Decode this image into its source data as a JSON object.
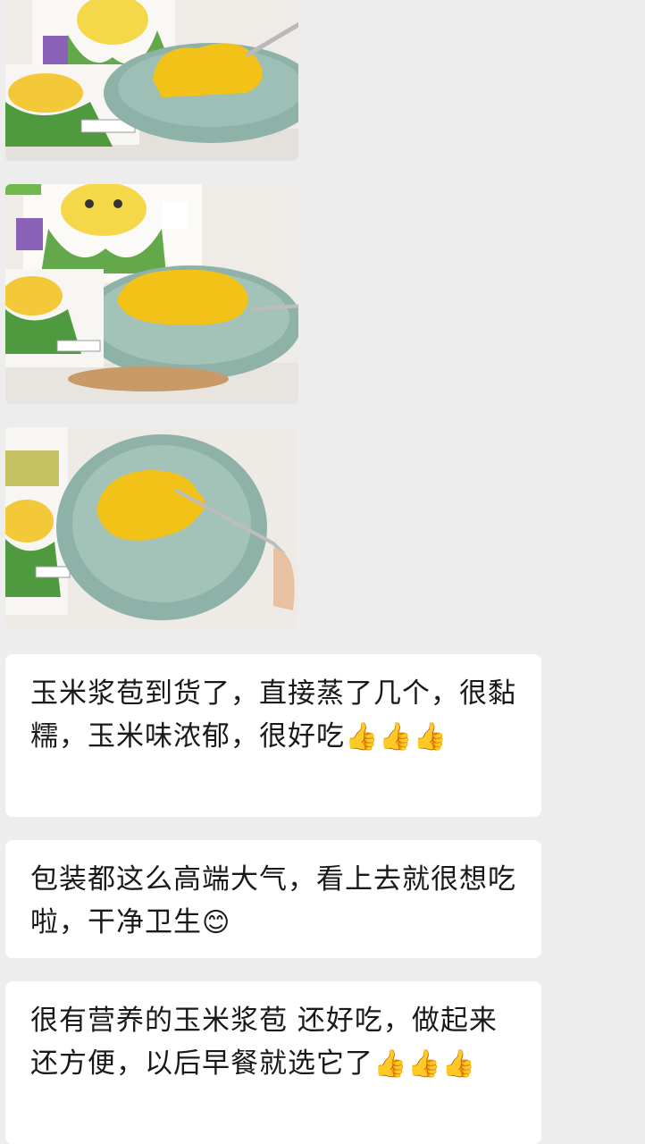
{
  "chat": {
    "images": [
      {
        "name": "corn cake photo 1"
      },
      {
        "name": "corn cake photo 2"
      },
      {
        "name": "corn cake photo 3"
      }
    ],
    "messages": [
      {
        "text": "玉米浆苞到货了，直接蒸了几个，很黏糯，玉米味浓郁，很好吃",
        "emojis": "👍👍👍"
      },
      {
        "text": "包装都这么高端大气，看上去就很想吃啦，干净卫生",
        "emojis": "😊"
      },
      {
        "text": "很有营养的玉米浆苞 还好吃，做起来还方便，以后早餐就选它了",
        "emojis": "👍👍👍"
      }
    ]
  }
}
